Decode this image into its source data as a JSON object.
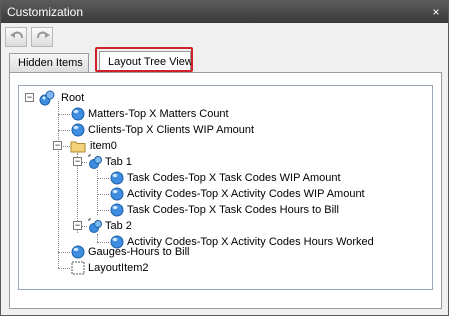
{
  "window": {
    "title": "Customization",
    "close_glyph": "×"
  },
  "toolbar": {
    "undo_icon": "undo-icon",
    "redo_icon": "redo-icon"
  },
  "tabs": [
    {
      "label": "Hidden Items",
      "active": false
    },
    {
      "label": "Layout Tree View",
      "active": true
    }
  ],
  "tree": {
    "root": "Root",
    "matters": "Matters-Top X Matters Count",
    "clients": "Clients-Top X Clients WIP Amount",
    "item0": "item0",
    "tab1": "Tab 1",
    "tab1_task_wip": "Task Codes-Top X Task Codes WIP Amount",
    "tab1_activity_wip": "Activity Codes-Top X Activity Codes WIP Amount",
    "tab1_task_hours": "Task Codes-Top X Task Codes Hours to Bill",
    "tab2": "Tab 2",
    "tab2_activity_hours": "Activity Codes-Top X Activity Codes Hours Worked",
    "gauges": "Gauges-Hours to Bill",
    "layout_item2": "LayoutItem2",
    "expander_glyph": "−"
  },
  "colors": {
    "highlight": "#d0202a",
    "sphere": "#3d8ee0",
    "folder": "#f2d27a"
  }
}
